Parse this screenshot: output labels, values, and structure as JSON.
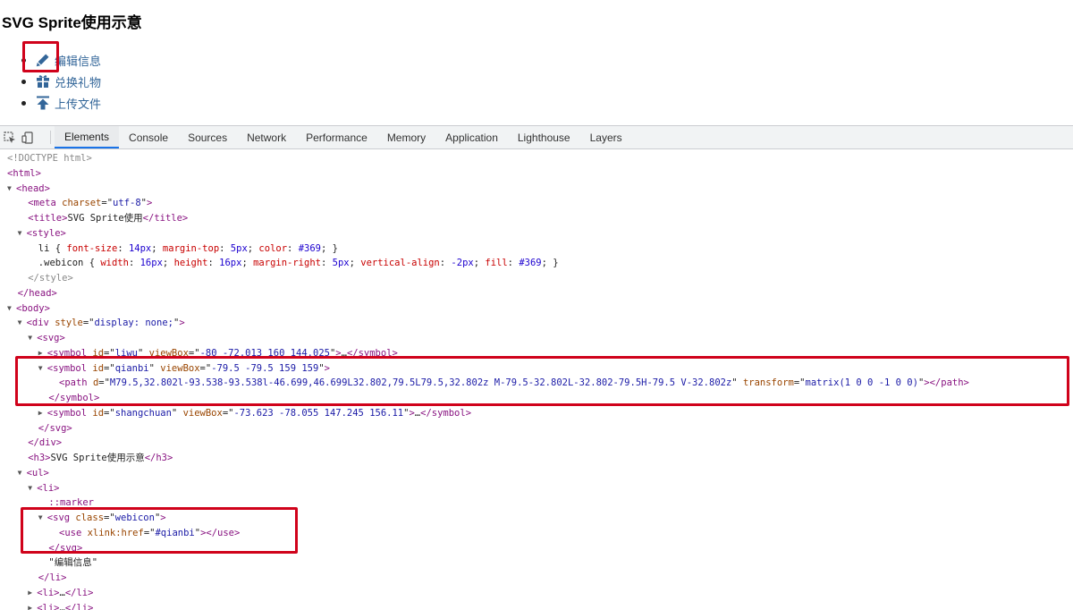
{
  "preview": {
    "heading": "SVG Sprite使用示意",
    "items": [
      {
        "label": "编辑信息",
        "icon": "pencil-icon"
      },
      {
        "label": "兑换礼物",
        "icon": "gift-icon"
      },
      {
        "label": "上传文件",
        "icon": "upload-icon"
      }
    ]
  },
  "devtools": {
    "tabs": [
      "Elements",
      "Console",
      "Sources",
      "Network",
      "Performance",
      "Memory",
      "Application",
      "Lighthouse",
      "Layers"
    ],
    "active_tab": "Elements",
    "lines": [
      {
        "i": 0,
        "tri": "",
        "html": "<span class=\"grey\">&lt;!DOCTYPE html&gt;</span>"
      },
      {
        "i": 0,
        "tri": "",
        "html": "<span class=\"tag\">&lt;html&gt;</span>"
      },
      {
        "i": 0,
        "tri": "▼",
        "html": "<span class=\"tag\">&lt;head&gt;</span>"
      },
      {
        "i": 2,
        "tri": "",
        "html": "<span class=\"tag\">&lt;meta </span><span class=\"an\">charset</span><span class=\"eq\">=\"</span><span class=\"av\">utf-8</span><span class=\"eq\">\"</span><span class=\"tag\">&gt;</span>"
      },
      {
        "i": 2,
        "tri": "",
        "html": "<span class=\"tag\">&lt;title&gt;</span><span class=\"txt\">SVG Sprite使用</span><span class=\"tag\">&lt;/title&gt;</span>"
      },
      {
        "i": 1,
        "tri": "▼",
        "html": "<span class=\"tag\">&lt;style&gt;</span>"
      },
      {
        "i": 3,
        "tri": "",
        "html": "<span class=\"txt\">li { </span><span class=\"css-prop\">font-size</span>: <span class=\"css-num\">14px</span>; <span class=\"css-prop\">margin-top</span>: <span class=\"css-num\">5px</span>; <span class=\"css-prop\">color</span>: <span class=\"css-num\">#369</span>; }"
      },
      {
        "i": 3,
        "tri": "",
        "html": "<span class=\"txt\">.webicon { </span><span class=\"css-prop\">width</span>: <span class=\"css-num\">16px</span>; <span class=\"css-prop\">height</span>: <span class=\"css-num\">16px</span>; <span class=\"css-prop\">margin-right</span>: <span class=\"css-num\">5px</span>; <span class=\"css-prop\">vertical-align</span>: <span class=\"css-num\">-2px</span>; <span class=\"css-prop\">fill</span>: <span class=\"css-num\">#369</span>; }"
      },
      {
        "i": 2,
        "tri": "",
        "html": "<span class=\"grey\">&lt;/style&gt;</span>"
      },
      {
        "i": 1,
        "tri": "",
        "html": "<span class=\"tag\">&lt;/head&gt;</span>"
      },
      {
        "i": 0,
        "tri": "▼",
        "html": "<span class=\"tag\">&lt;body&gt;</span>"
      },
      {
        "i": 1,
        "tri": "▼",
        "html": "<span class=\"tag\">&lt;div </span><span class=\"an\">style</span><span class=\"eq\">=\"</span><span class=\"av\">display: none;</span><span class=\"eq\">\"</span><span class=\"tag\">&gt;</span>"
      },
      {
        "i": 2,
        "tri": "▼",
        "html": "<span class=\"tag\">&lt;svg&gt;</span>"
      },
      {
        "i": 3,
        "tri": "▶",
        "html": "<span class=\"tag\">&lt;symbol </span><span class=\"an\">id</span><span class=\"eq\">=\"</span><span class=\"av\">liwu</span><span class=\"eq\">\"</span> <span class=\"an\">viewBox</span><span class=\"eq\">=\"</span><span class=\"av\">-80 -72.013 160 144.025</span><span class=\"eq\">\"</span><span class=\"tag\">&gt;</span>…<span class=\"tag\">&lt;/symbol&gt;</span>"
      },
      {
        "i": 3,
        "tri": "▼",
        "html": "<span class=\"tag\">&lt;symbol </span><span class=\"an\">id</span><span class=\"eq\">=\"</span><span class=\"av\">qianbi</span><span class=\"eq\">\"</span> <span class=\"an\">viewBox</span><span class=\"eq\">=\"</span><span class=\"av\">-79.5 -79.5 159 159</span><span class=\"eq\">\"</span><span class=\"tag\">&gt;</span>"
      },
      {
        "i": 5,
        "tri": "",
        "html": "<span class=\"tag\">&lt;path </span><span class=\"an\">d</span><span class=\"eq\">=\"</span><span class=\"av\">M79.5,32.802l-93.538-93.538l-46.699,46.699L32.802,79.5L79.5,32.802z M-79.5-32.802L-32.802-79.5H-79.5 V-32.802z</span><span class=\"eq\">\"</span> <span class=\"an\">transform</span><span class=\"eq\">=\"</span><span class=\"av\">matrix(1 0 0 -1 0 0)</span><span class=\"eq\">\"</span><span class=\"tag\">&gt;&lt;/path&gt;</span>"
      },
      {
        "i": 4,
        "tri": "",
        "html": "<span class=\"tag\">&lt;/symbol&gt;</span>"
      },
      {
        "i": 3,
        "tri": "▶",
        "html": "<span class=\"tag\">&lt;symbol </span><span class=\"an\">id</span><span class=\"eq\">=\"</span><span class=\"av\">shangchuan</span><span class=\"eq\">\"</span> <span class=\"an\">viewBox</span><span class=\"eq\">=\"</span><span class=\"av\">-73.623 -78.055 147.245 156.11</span><span class=\"eq\">\"</span><span class=\"tag\">&gt;</span>…<span class=\"tag\">&lt;/symbol&gt;</span>"
      },
      {
        "i": 3,
        "tri": "",
        "html": "<span class=\"tag\">&lt;/svg&gt;</span>"
      },
      {
        "i": 2,
        "tri": "",
        "html": "<span class=\"tag\">&lt;/div&gt;</span>"
      },
      {
        "i": 2,
        "tri": "",
        "html": "<span class=\"tag\">&lt;h3&gt;</span><span class=\"txt\">SVG Sprite使用示意</span><span class=\"tag\">&lt;/h3&gt;</span>"
      },
      {
        "i": 1,
        "tri": "▼",
        "html": "<span class=\"tag\">&lt;ul&gt;</span>"
      },
      {
        "i": 2,
        "tri": "▼",
        "html": "<span class=\"tag\">&lt;li&gt;</span>"
      },
      {
        "i": 4,
        "tri": "",
        "html": "<span class=\"pseudo\">::marker</span>"
      },
      {
        "i": 3,
        "tri": "▼",
        "html": "<span class=\"tag\">&lt;svg </span><span class=\"an\">class</span><span class=\"eq\">=\"</span><span class=\"av\">webicon</span><span class=\"eq\">\"</span><span class=\"tag\">&gt;</span>"
      },
      {
        "i": 5,
        "tri": "",
        "html": "<span class=\"tag\">&lt;use </span><span class=\"an\">xlink:href</span><span class=\"eq\">=\"</span><span class=\"av\">#qianbi</span><span class=\"eq\">\"</span><span class=\"tag\">&gt;&lt;/use&gt;</span>"
      },
      {
        "i": 4,
        "tri": "",
        "html": "<span class=\"tag\">&lt;/svg&gt;</span>"
      },
      {
        "i": 4,
        "tri": "",
        "html": "<span class=\"txt\">\"编辑信息\"</span>"
      },
      {
        "i": 3,
        "tri": "",
        "html": "<span class=\"tag\">&lt;/li&gt;</span>"
      },
      {
        "i": 2,
        "tri": "▶",
        "html": "<span class=\"tag\">&lt;li&gt;</span>…<span class=\"tag\">&lt;/li&gt;</span>"
      },
      {
        "i": 2,
        "tri": "▶",
        "html": "<span class=\"tag\">&lt;li&gt;</span>…<span class=\"tag\">&lt;/li&gt;</span>"
      }
    ]
  }
}
